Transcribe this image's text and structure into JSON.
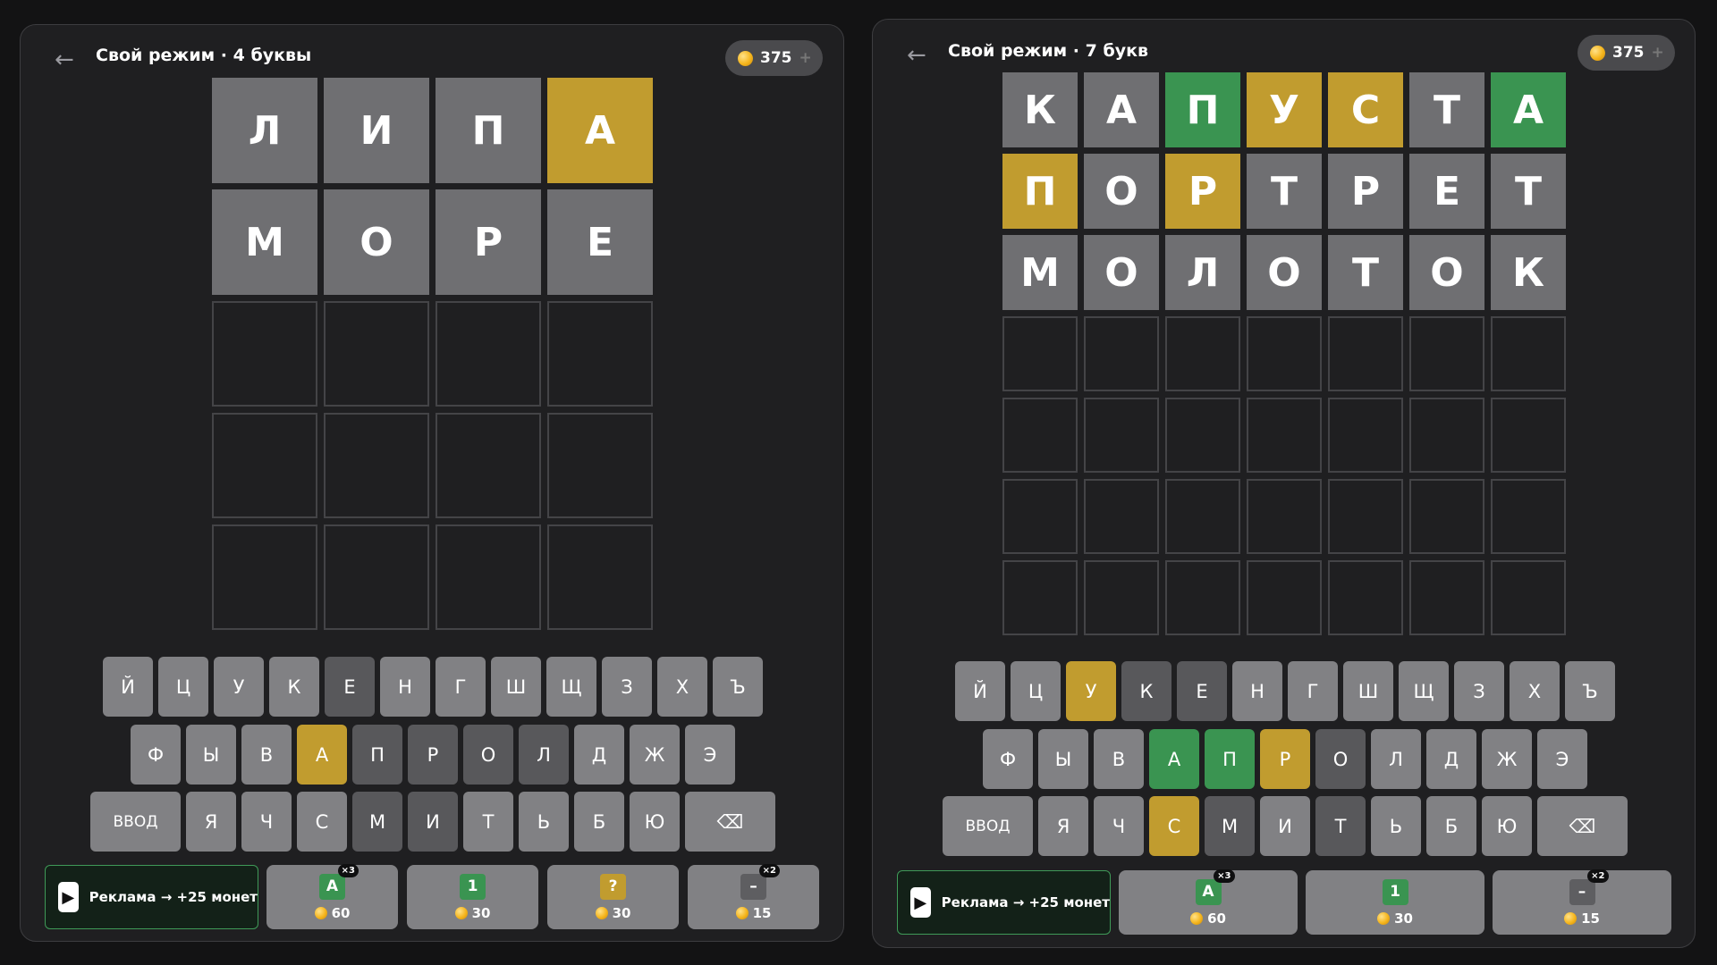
{
  "left": {
    "back_symbol": "←",
    "title": "Свой режим · 4 буквы",
    "coins": "375",
    "plus": "+",
    "rows": [
      [
        {
          "l": "Л",
          "s": "gray"
        },
        {
          "l": "И",
          "s": "gray"
        },
        {
          "l": "П",
          "s": "gray"
        },
        {
          "l": "А",
          "s": "yellow"
        }
      ],
      [
        {
          "l": "М",
          "s": "gray"
        },
        {
          "l": "О",
          "s": "gray"
        },
        {
          "l": "Р",
          "s": "gray"
        },
        {
          "l": "Е",
          "s": "gray"
        }
      ],
      [
        {
          "l": "",
          "s": "empty"
        },
        {
          "l": "",
          "s": "empty"
        },
        {
          "l": "",
          "s": "empty"
        },
        {
          "l": "",
          "s": "empty"
        }
      ],
      [
        {
          "l": "",
          "s": "empty"
        },
        {
          "l": "",
          "s": "empty"
        },
        {
          "l": "",
          "s": "empty"
        },
        {
          "l": "",
          "s": "empty"
        }
      ],
      [
        {
          "l": "",
          "s": "empty"
        },
        {
          "l": "",
          "s": "empty"
        },
        {
          "l": "",
          "s": "empty"
        },
        {
          "l": "",
          "s": "empty"
        }
      ]
    ],
    "keyboard": [
      [
        {
          "k": "Й"
        },
        {
          "k": "Ц"
        },
        {
          "k": "У"
        },
        {
          "k": "К"
        },
        {
          "k": "Е",
          "s": "dark"
        },
        {
          "k": "Н"
        },
        {
          "k": "Г"
        },
        {
          "k": "Ш"
        },
        {
          "k": "Щ"
        },
        {
          "k": "З"
        },
        {
          "k": "Х"
        },
        {
          "k": "Ъ"
        }
      ],
      [
        {
          "k": "Ф"
        },
        {
          "k": "Ы"
        },
        {
          "k": "В"
        },
        {
          "k": "А",
          "s": "yellow"
        },
        {
          "k": "П",
          "s": "dark"
        },
        {
          "k": "Р",
          "s": "dark"
        },
        {
          "k": "О",
          "s": "dark"
        },
        {
          "k": "Л",
          "s": "dark"
        },
        {
          "k": "Д"
        },
        {
          "k": "Ж"
        },
        {
          "k": "Э"
        }
      ],
      [
        {
          "k": "ВВОД",
          "w": "wide"
        },
        {
          "k": "Я"
        },
        {
          "k": "Ч"
        },
        {
          "k": "С"
        },
        {
          "k": "М",
          "s": "dark"
        },
        {
          "k": "И",
          "s": "dark"
        },
        {
          "k": "Т"
        },
        {
          "k": "Ь"
        },
        {
          "k": "Б"
        },
        {
          "k": "Ю"
        },
        {
          "k": "⌫",
          "w": "wide"
        }
      ]
    ],
    "ad_label": "Реклама → +25 монет",
    "powerups": [
      {
        "icon": "А",
        "color": "green",
        "mult": "×3",
        "cost": "60",
        "name": "reveal-letter"
      },
      {
        "icon": "1",
        "color": "green",
        "mult": "",
        "cost": "30",
        "name": "reveal-position"
      },
      {
        "icon": "?",
        "color": "yellow",
        "mult": "",
        "cost": "30",
        "name": "hint"
      },
      {
        "icon": "–",
        "color": "gray",
        "mult": "×2",
        "cost": "15",
        "name": "remove-letters"
      }
    ]
  },
  "right": {
    "back_symbol": "←",
    "title": "Свой режим · 7 букв",
    "coins": "375",
    "plus": "+",
    "rows": [
      [
        {
          "l": "К",
          "s": "gray"
        },
        {
          "l": "А",
          "s": "gray"
        },
        {
          "l": "П",
          "s": "green"
        },
        {
          "l": "У",
          "s": "yellow"
        },
        {
          "l": "С",
          "s": "yellow"
        },
        {
          "l": "Т",
          "s": "gray"
        },
        {
          "l": "А",
          "s": "green"
        }
      ],
      [
        {
          "l": "П",
          "s": "yellow"
        },
        {
          "l": "О",
          "s": "gray"
        },
        {
          "l": "Р",
          "s": "yellow"
        },
        {
          "l": "Т",
          "s": "gray"
        },
        {
          "l": "Р",
          "s": "gray"
        },
        {
          "l": "Е",
          "s": "gray"
        },
        {
          "l": "Т",
          "s": "gray"
        }
      ],
      [
        {
          "l": "М",
          "s": "gray"
        },
        {
          "l": "О",
          "s": "gray"
        },
        {
          "l": "Л",
          "s": "gray"
        },
        {
          "l": "О",
          "s": "gray"
        },
        {
          "l": "Т",
          "s": "gray"
        },
        {
          "l": "О",
          "s": "gray"
        },
        {
          "l": "К",
          "s": "gray"
        }
      ],
      [
        {
          "l": "",
          "s": "empty"
        },
        {
          "l": "",
          "s": "empty"
        },
        {
          "l": "",
          "s": "empty"
        },
        {
          "l": "",
          "s": "empty"
        },
        {
          "l": "",
          "s": "empty"
        },
        {
          "l": "",
          "s": "empty"
        },
        {
          "l": "",
          "s": "empty"
        }
      ],
      [
        {
          "l": "",
          "s": "empty"
        },
        {
          "l": "",
          "s": "empty"
        },
        {
          "l": "",
          "s": "empty"
        },
        {
          "l": "",
          "s": "empty"
        },
        {
          "l": "",
          "s": "empty"
        },
        {
          "l": "",
          "s": "empty"
        },
        {
          "l": "",
          "s": "empty"
        }
      ],
      [
        {
          "l": "",
          "s": "empty"
        },
        {
          "l": "",
          "s": "empty"
        },
        {
          "l": "",
          "s": "empty"
        },
        {
          "l": "",
          "s": "empty"
        },
        {
          "l": "",
          "s": "empty"
        },
        {
          "l": "",
          "s": "empty"
        },
        {
          "l": "",
          "s": "empty"
        }
      ],
      [
        {
          "l": "",
          "s": "empty"
        },
        {
          "l": "",
          "s": "empty"
        },
        {
          "l": "",
          "s": "empty"
        },
        {
          "l": "",
          "s": "empty"
        },
        {
          "l": "",
          "s": "empty"
        },
        {
          "l": "",
          "s": "empty"
        },
        {
          "l": "",
          "s": "empty"
        }
      ]
    ],
    "keyboard": [
      [
        {
          "k": "Й"
        },
        {
          "k": "Ц"
        },
        {
          "k": "У",
          "s": "yellow"
        },
        {
          "k": "К",
          "s": "dark"
        },
        {
          "k": "Е",
          "s": "dark"
        },
        {
          "k": "Н"
        },
        {
          "k": "Г"
        },
        {
          "k": "Ш"
        },
        {
          "k": "Щ"
        },
        {
          "k": "З"
        },
        {
          "k": "Х"
        },
        {
          "k": "Ъ"
        }
      ],
      [
        {
          "k": "Ф"
        },
        {
          "k": "Ы"
        },
        {
          "k": "В"
        },
        {
          "k": "А",
          "s": "green"
        },
        {
          "k": "П",
          "s": "green"
        },
        {
          "k": "Р",
          "s": "yellow"
        },
        {
          "k": "О",
          "s": "dark"
        },
        {
          "k": "Л"
        },
        {
          "k": "Д"
        },
        {
          "k": "Ж"
        },
        {
          "k": "Э"
        }
      ],
      [
        {
          "k": "ВВОД",
          "w": "wide"
        },
        {
          "k": "Я"
        },
        {
          "k": "Ч"
        },
        {
          "k": "С",
          "s": "yellow"
        },
        {
          "k": "М",
          "s": "dark"
        },
        {
          "k": "И"
        },
        {
          "k": "Т",
          "s": "dark"
        },
        {
          "k": "Ь"
        },
        {
          "k": "Б"
        },
        {
          "k": "Ю"
        },
        {
          "k": "⌫",
          "w": "wide"
        }
      ]
    ],
    "ad_label": "Реклама → +25 монет",
    "powerups": [
      {
        "icon": "А",
        "color": "green",
        "mult": "×3",
        "cost": "60",
        "name": "reveal-letter"
      },
      {
        "icon": "1",
        "color": "green",
        "mult": "",
        "cost": "30",
        "name": "reveal-position"
      },
      {
        "icon": "–",
        "color": "gray",
        "mult": "×2",
        "cost": "15",
        "name": "remove-letters"
      }
    ]
  }
}
